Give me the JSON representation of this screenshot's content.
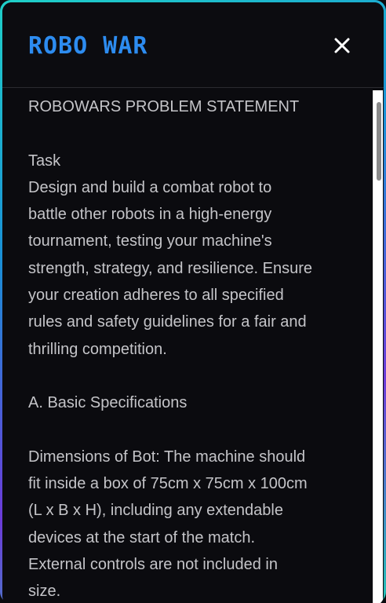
{
  "modal": {
    "title": "ROBO WAR",
    "close_icon": "close-icon",
    "accent_color": "#2d8cf0",
    "content": "ROBOWARS PROBLEM STATEMENT\n\nTask\nDesign and build a combat robot to\nbattle other robots in a high-energy\ntournament, testing your machine's\nstrength, strategy, and resilience. Ensure\nyour creation adheres to all specified\nrules and safety guidelines for a fair and\nthrilling competition.\n\nA. Basic Specifications\n\nDimensions of Bot: The machine should\nfit inside a box of 75cm x 75cm x 100cm\n(L x B x H), including any extendable\ndevices at the start of the match.\nExternal controls are not included in\nsize."
  }
}
